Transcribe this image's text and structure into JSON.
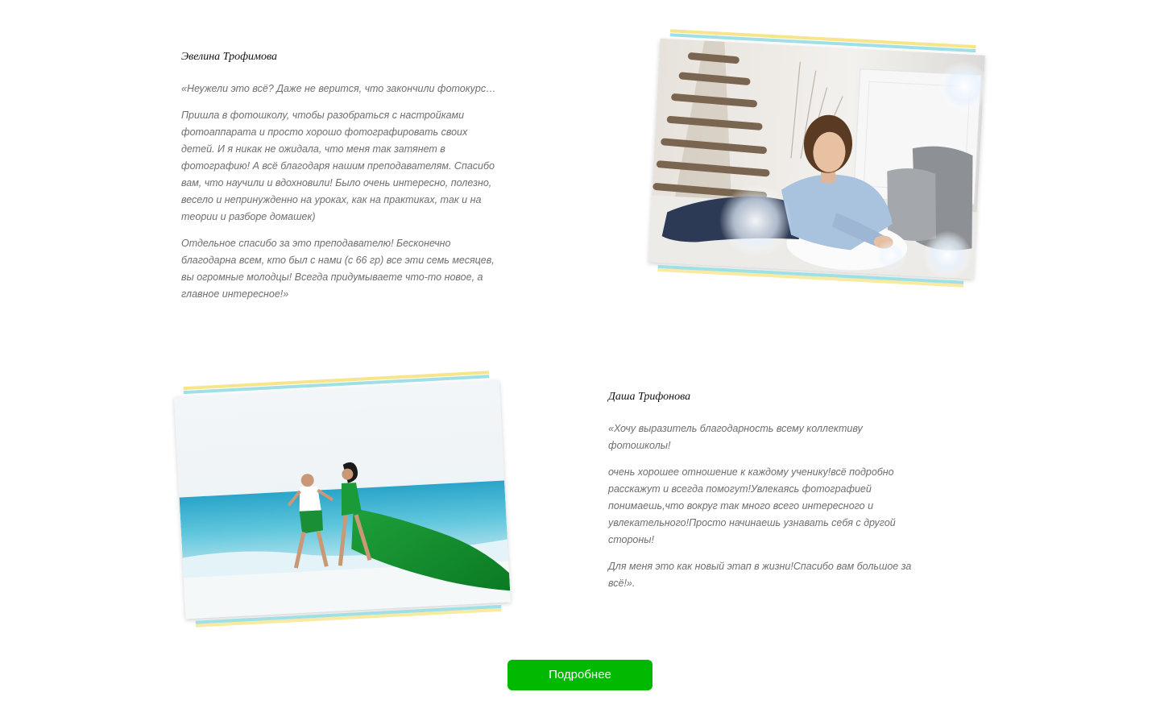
{
  "reviews": [
    {
      "name": "Эвелина Трофимова",
      "paragraphs": [
        "«Неужели это всё? Даже не верится, что закончили фотокурс…",
        "Пришла в фотошколу, чтобы разобраться с настройками фотоаппарата и просто хорошо фотографировать своих детей. И я никак не ожидала, что меня так затянет в фотографию! А всё благодаря нашим преподавателям. Спасибо вам, что научили и вдохновили! Было очень интересно, полезно, весело и непринужденно на уроках, как на практиках, так и на теории и разборе домашек)",
        "Отдельное спасибо за это преподавателю! Бесконечно благодарна всем, кто был с нами (с 66 гр) все эти семь месяцев, вы огромные молодцы! Всегда придумываете что-то новое, а главное интересное!»"
      ]
    },
    {
      "name": "Даша Трифонова",
      "paragraphs": [
        "«Хочу выразитель благодарность всему коллективу фотошколы!",
        "очень хорошее отношение к каждому ученику!всё подробно расскажут и всегда помогут!Увлекаясь фотографией понимаешь,что вокруг так много всего интересного и увлекательного!Просто начинаешь узнавать себя с другой стороны!",
        "Для меня это как новый этап в жизни!Спасибо вам большое за всё!»."
      ]
    }
  ],
  "more_button": {
    "label": "Подробнее"
  },
  "colors": {
    "button": "#00b900",
    "stripe_blue": "#9ee0e6",
    "stripe_yellow": "#f6e58a",
    "text": "#6e6e6e"
  }
}
